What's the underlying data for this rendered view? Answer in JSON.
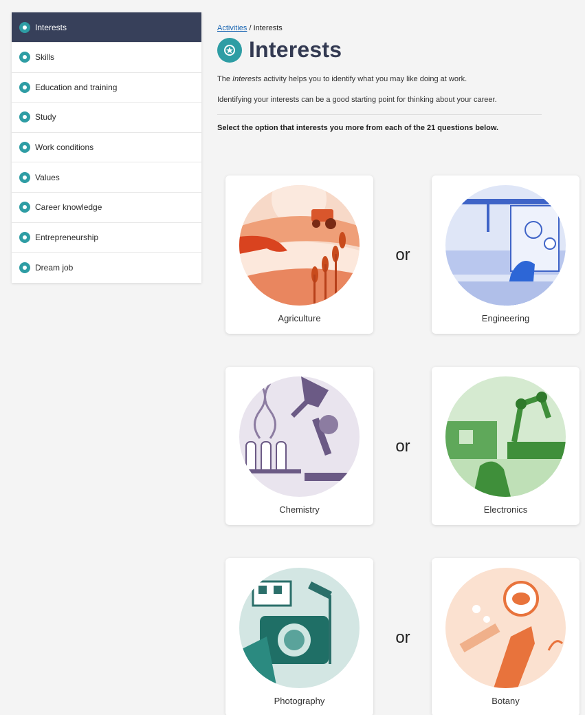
{
  "sidebar": {
    "items": [
      {
        "label": "Interests",
        "icon": "interests-icon",
        "active": true
      },
      {
        "label": "Skills",
        "icon": "skills-icon"
      },
      {
        "label": "Education and training",
        "icon": "education-icon"
      },
      {
        "label": "Study",
        "icon": "study-icon"
      },
      {
        "label": "Work conditions",
        "icon": "work-conditions-icon"
      },
      {
        "label": "Values",
        "icon": "values-icon"
      },
      {
        "label": "Career knowledge",
        "icon": "career-knowledge-icon"
      },
      {
        "label": "Entrepreneurship",
        "icon": "entrepreneurship-icon"
      },
      {
        "label": "Dream job",
        "icon": "dream-job-icon"
      }
    ]
  },
  "breadcrumb": {
    "link": "Activities",
    "separator": " / ",
    "current": "Interests"
  },
  "header": {
    "title": "Interests",
    "icon": "interests-star-icon"
  },
  "intro": {
    "prefix": "The ",
    "emphasis": "Interests",
    "suffix": " activity helps you to identify what you may like doing at work.",
    "line2": "Identifying your interests can be a good starting point for thinking about your career."
  },
  "instruction": "Select the option that interests you more from each of the 21 questions below.",
  "questions": [
    {
      "left": "Agriculture",
      "or": "or",
      "right": "Engineering"
    },
    {
      "left": "Chemistry",
      "or": "or",
      "right": "Electronics"
    },
    {
      "left": "Photography",
      "or": "or",
      "right": "Botany"
    }
  ],
  "colors": {
    "sidebar_active": "#37405a",
    "accent_teal": "#2e9da4",
    "title": "#333a52",
    "link": "#1a66b3"
  }
}
